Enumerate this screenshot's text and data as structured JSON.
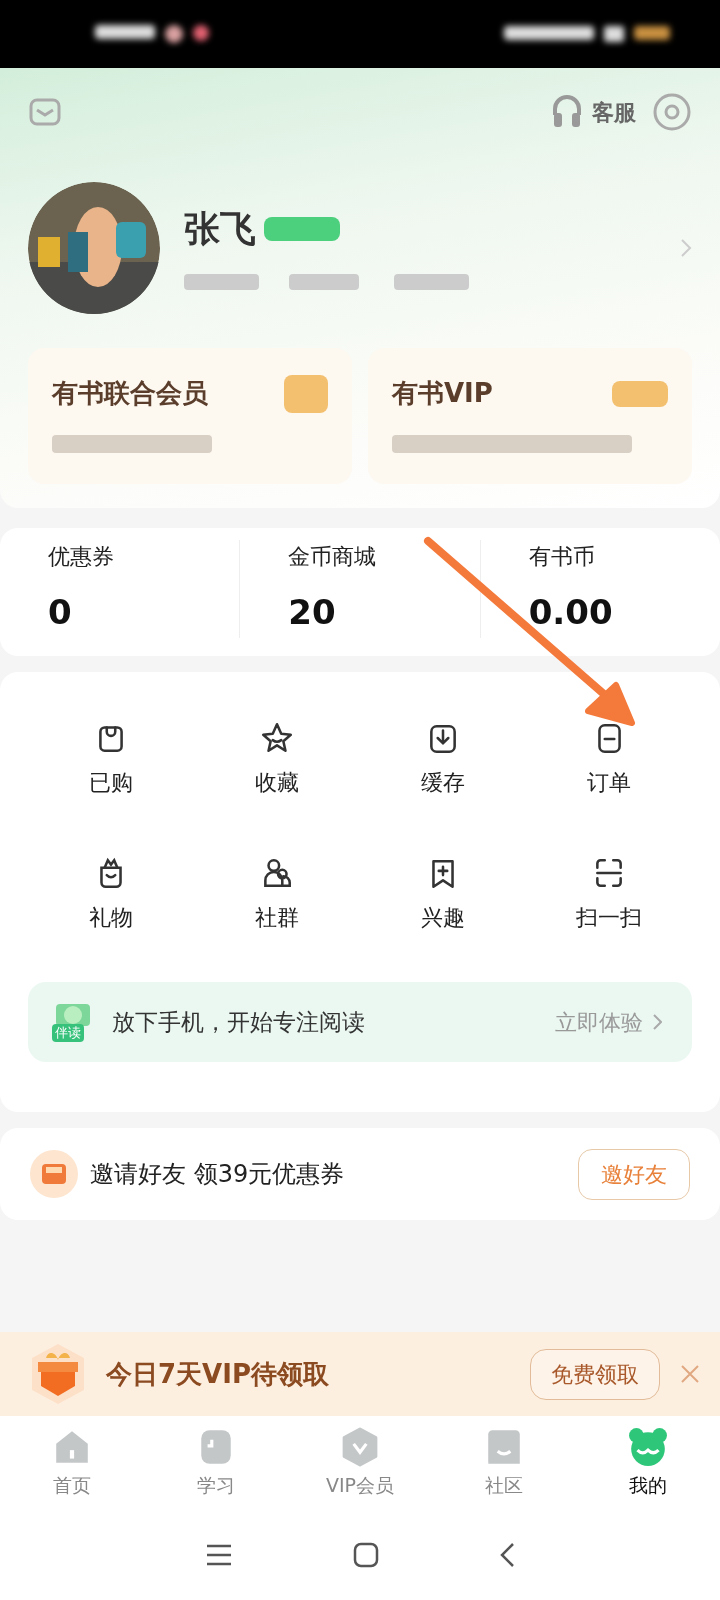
{
  "header": {
    "service_label": "客服"
  },
  "profile": {
    "name": "张飞"
  },
  "memberships": [
    {
      "title": "有书联合会员"
    },
    {
      "title": "有书VIP"
    }
  ],
  "stats": [
    {
      "label": "优惠券",
      "value": "0"
    },
    {
      "label": "金币商城",
      "value": "20"
    },
    {
      "label": "有书币",
      "value": "0.00"
    }
  ],
  "shortcuts": [
    {
      "label": "已购",
      "kind": "bag"
    },
    {
      "label": "收藏",
      "kind": "star"
    },
    {
      "label": "缓存",
      "kind": "download"
    },
    {
      "label": "订单",
      "kind": "order"
    },
    {
      "label": "礼物",
      "kind": "gift"
    },
    {
      "label": "社群",
      "kind": "group"
    },
    {
      "label": "兴趣",
      "kind": "bookmark"
    },
    {
      "label": "扫一扫",
      "kind": "scan"
    }
  ],
  "focus_banner": {
    "badge": "伴读",
    "text": "放下手机，开始专注阅读",
    "action": "立即体验"
  },
  "invite": {
    "text": "邀请好友 领39元优惠券",
    "button": "邀好友"
  },
  "vip_promo": {
    "text": "今日7天VIP待领取",
    "button": "免费领取"
  },
  "tabs": [
    {
      "label": "首页",
      "kind": "home",
      "selected": false
    },
    {
      "label": "学习",
      "kind": "study",
      "selected": false
    },
    {
      "label": "VIP会员",
      "kind": "vip",
      "selected": false
    },
    {
      "label": "社区",
      "kind": "community",
      "selected": false
    },
    {
      "label": "我的",
      "kind": "mine",
      "selected": true
    }
  ]
}
